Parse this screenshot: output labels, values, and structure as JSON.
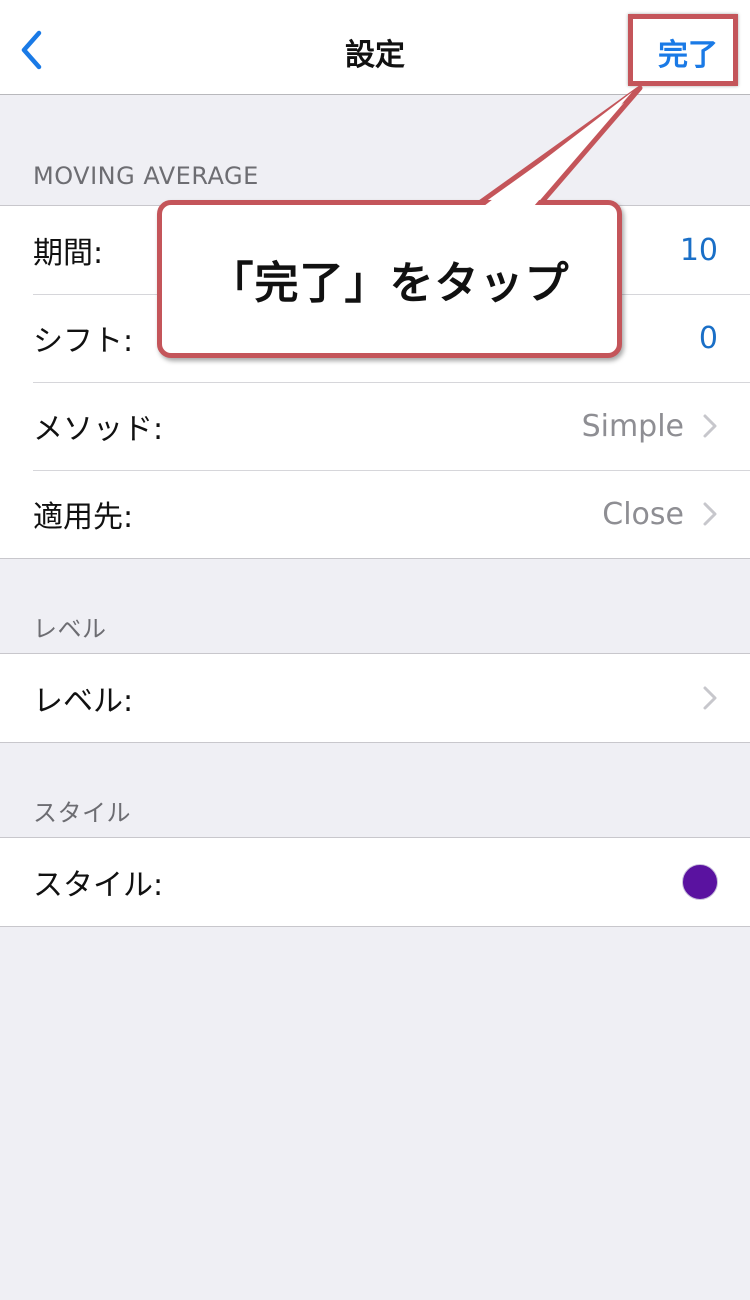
{
  "nav": {
    "title": "設定",
    "done_label": "完了",
    "back_icon": "chevron-left-icon"
  },
  "sections": {
    "moving_average": {
      "header": "MOVING AVERAGE",
      "rows": [
        {
          "label": "期間:",
          "value": "10"
        },
        {
          "label": "シフト:",
          "value": "0"
        },
        {
          "label": "メソッド:",
          "value": "Simple"
        },
        {
          "label": "適用先:",
          "value": "Close"
        }
      ]
    },
    "level": {
      "header": "レベル",
      "rows": [
        {
          "label": "レベル:"
        }
      ]
    },
    "style": {
      "header": "スタイル",
      "rows": [
        {
          "label": "スタイル:",
          "color": "#5a12a0"
        }
      ]
    }
  },
  "annotation": {
    "text": "「完了」をタップ",
    "color": "#c4555a"
  },
  "colors": {
    "accent": "#1a7ae6",
    "background": "#efeff4"
  }
}
